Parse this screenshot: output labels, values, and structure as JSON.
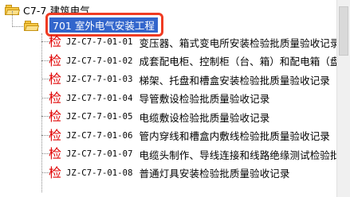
{
  "tree": {
    "root": {
      "label": "C7-7 建筑电气"
    },
    "selected": {
      "label": "701 室外电气安装工程"
    },
    "items": [
      {
        "code": "JZ-C7-7-01-01",
        "title": "变压器、箱式变电所安装检验批质量验收记录"
      },
      {
        "code": "JZ-C7-7-01-02",
        "title": "成套配电柜、控制柜（台、箱）和配电箱（盘）安"
      },
      {
        "code": "JZ-C7-7-01-03",
        "title": "梯架、托盘和槽盒安装检验批质量验收记录"
      },
      {
        "code": "JZ-C7-7-01-04",
        "title": "导管敷设检验批质量验收记录"
      },
      {
        "code": "JZ-C7-7-01-05",
        "title": "电缆敷设检验批质量验收记录"
      },
      {
        "code": "JZ-C7-7-01-06",
        "title": "管内穿线和槽盒内敷线检验批质量验收记录"
      },
      {
        "code": "JZ-C7-7-01-07",
        "title": "电缆头制作、导线连接和线路绝缘测试检验批质"
      },
      {
        "code": "JZ-C7-7-01-08",
        "title": "普通灯具安装检验批质量验收记录"
      }
    ],
    "item_icon_char": "检",
    "item_icon": "inspection-doc-icon",
    "folder_icon": "folder-open-icon"
  },
  "colors": {
    "selection_bg": "#3366cc",
    "highlight_border": "#f03b22",
    "item_icon": "#e00000",
    "folder": "#f7c844"
  }
}
